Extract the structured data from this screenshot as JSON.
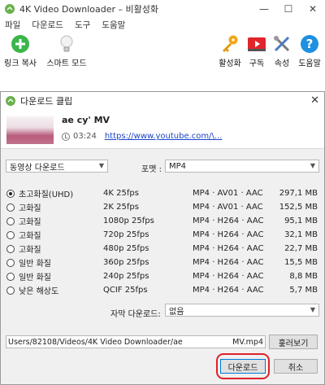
{
  "main": {
    "title": "4K Video Downloader – 비활성화",
    "win_controls": [
      "—",
      "☐",
      "✕"
    ],
    "menu": [
      "파일",
      "다운로드",
      "도구",
      "도움말"
    ],
    "toolbar": {
      "paste_link": "링크 복사",
      "smart_mode": "스마트 모드",
      "activate": "활성화",
      "subscribe": "구독",
      "preferences": "속성",
      "help": "도움말"
    },
    "icons": {
      "paste_link": "plus-circle-icon",
      "smart_mode": "lightbulb-icon",
      "activate": "key-icon",
      "subscribe": "youtube-icon",
      "preferences": "wrench-screwdriver-icon",
      "help": "question-circle-icon"
    }
  },
  "dialog": {
    "title": "다운로드 클립",
    "close": "✕",
    "clip": {
      "title": "ae                 cy' MV",
      "duration": "03:24",
      "url": "https://www.youtube.com/\\..."
    },
    "type_select": "동영상 다운로드",
    "format_label": "포맷 :",
    "format_select": "MP4",
    "qualities": [
      {
        "label": "초고화질(UHD)",
        "res": "4K 25fps",
        "format": "MP4 · AV01 · AAC",
        "size": "297,1 MB",
        "selected": true
      },
      {
        "label": "고화질",
        "res": "2K 25fps",
        "format": "MP4 · AV01 · AAC",
        "size": "152,5 MB",
        "selected": false
      },
      {
        "label": "고화질",
        "res": "1080p 25fps",
        "format": "MP4 · H264 · AAC",
        "size": "95,1 MB",
        "selected": false
      },
      {
        "label": "고화질",
        "res": "720p 25fps",
        "format": "MP4 · H264 · AAC",
        "size": "32,1 MB",
        "selected": false
      },
      {
        "label": "고화질",
        "res": "480p 25fps",
        "format": "MP4 · H264 · AAC",
        "size": "22,7 MB",
        "selected": false
      },
      {
        "label": "일반 화질",
        "res": "360p 25fps",
        "format": "MP4 · H264 · AAC",
        "size": "15,5 MB",
        "selected": false
      },
      {
        "label": "일반 화질",
        "res": "240p 25fps",
        "format": "MP4 · H264 · AAC",
        "size": "8,8 MB",
        "selected": false
      },
      {
        "label": "낮은 해상도",
        "res": "QCIF 25fps",
        "format": "MP4 · H264 · AAC",
        "size": "5,7 MB",
        "selected": false
      }
    ],
    "subtitle_label": "자막 다운로드:",
    "subtitle_select": "없음",
    "path_prefix": "Users/82108/Videos/4K Video Downloader/ae",
    "path_suffix": "MV.mp4",
    "browse": "훑러보기",
    "download": "다운로드",
    "cancel": "취소"
  },
  "colors": {
    "accent_red": "#e0202a",
    "brand_green": "#6ab04c",
    "link_blue": "#1a44c9"
  }
}
